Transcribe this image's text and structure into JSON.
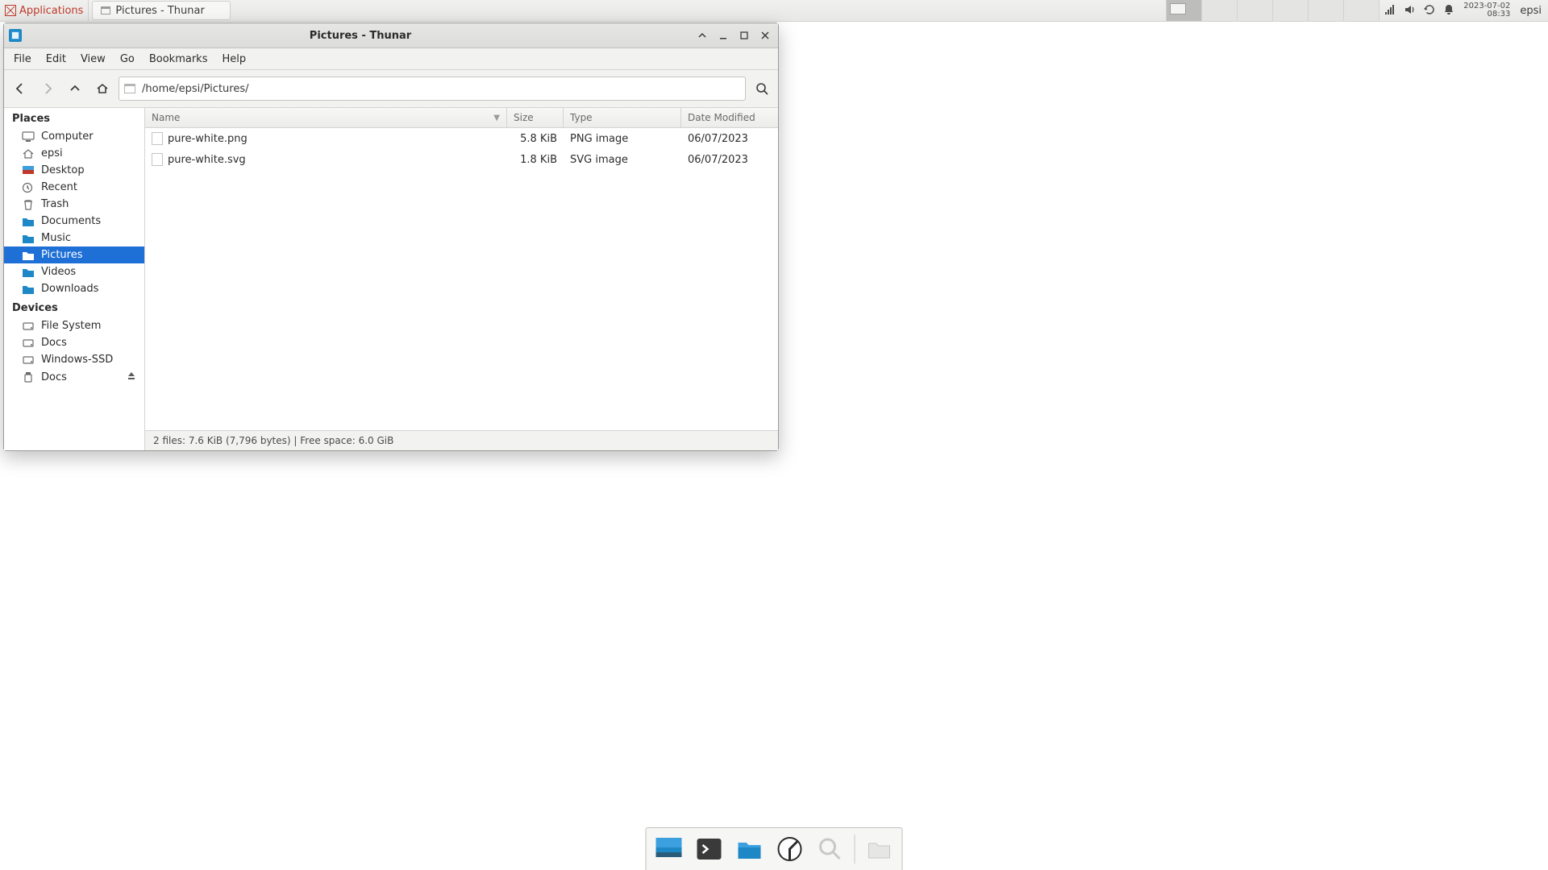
{
  "panel": {
    "applications_label": "Applications",
    "task_title": "Pictures - Thunar",
    "clock_date": "2023-07-02",
    "clock_time": "08:33",
    "user": "epsi",
    "workspace_count": 6,
    "active_workspace": 0
  },
  "window": {
    "title": "Pictures - Thunar",
    "menus": [
      "File",
      "Edit",
      "View",
      "Go",
      "Bookmarks",
      "Help"
    ],
    "path": "/home/epsi/Pictures/"
  },
  "sidebar": {
    "places_label": "Places",
    "places": [
      {
        "label": "Computer",
        "icon": "computer"
      },
      {
        "label": "epsi",
        "icon": "home"
      },
      {
        "label": "Desktop",
        "icon": "desktop"
      },
      {
        "label": "Recent",
        "icon": "recent"
      },
      {
        "label": "Trash",
        "icon": "trash"
      },
      {
        "label": "Documents",
        "icon": "folder"
      },
      {
        "label": "Music",
        "icon": "folder"
      },
      {
        "label": "Pictures",
        "icon": "folder",
        "selected": true
      },
      {
        "label": "Videos",
        "icon": "folder"
      },
      {
        "label": "Downloads",
        "icon": "folder"
      }
    ],
    "devices_label": "Devices",
    "devices": [
      {
        "label": "File System",
        "icon": "drive"
      },
      {
        "label": "Docs",
        "icon": "drive"
      },
      {
        "label": "Windows-SSD",
        "icon": "drive"
      },
      {
        "label": "Docs",
        "icon": "usb",
        "eject": true
      }
    ]
  },
  "columns": {
    "name": "Name",
    "size": "Size",
    "type": "Type",
    "date": "Date Modified"
  },
  "files": [
    {
      "name": "pure-white.png",
      "size": "5.8 KiB",
      "type": "PNG image",
      "date": "06/07/2023"
    },
    {
      "name": "pure-white.svg",
      "size": "1.8 KiB",
      "type": "SVG image",
      "date": "06/07/2023"
    }
  ],
  "status": "2 files: 7.6 KiB (7,796 bytes)  |  Free space: 6.0 GiB",
  "dock": {
    "items": [
      "show-desktop",
      "terminal",
      "files",
      "browser",
      "search",
      "folder"
    ]
  }
}
